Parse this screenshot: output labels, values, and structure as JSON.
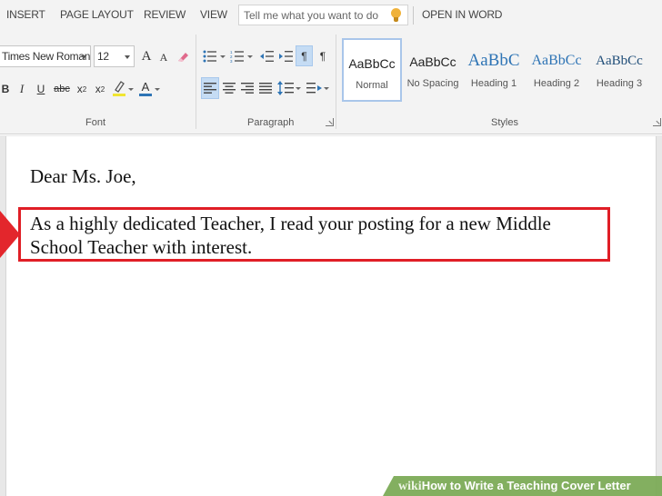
{
  "tabs": [
    "INSERT",
    "PAGE LAYOUT",
    "REVIEW",
    "VIEW"
  ],
  "tell_me": {
    "placeholder": "Tell me what you want to do"
  },
  "open_in_word": "OPEN IN WORD",
  "font_group": {
    "font_name": "Times New Roman",
    "font_size": "12",
    "bold": "B",
    "italic": "I",
    "underline": "U",
    "strike": "abc",
    "grow": "A",
    "shrink": "A",
    "font_color": "A",
    "label": "Font"
  },
  "paragraph_group": {
    "label": "Paragraph",
    "pilcrow": "¶"
  },
  "styles_group": {
    "label": "Styles",
    "sample": "AaBbCc",
    "heading_sample": "AaBbC",
    "styles": [
      "Normal",
      "No Spacing",
      "Heading 1",
      "Heading 2",
      "Heading 3"
    ]
  },
  "document": {
    "salutation": "Dear Ms. Joe,",
    "paragraph": "As a highly dedicated Teacher, I read your posting for a new Middle School Teacher with interest."
  },
  "banner": {
    "wiki": "wiki",
    "text": "How to Write a Teaching Cover Letter"
  },
  "colors": {
    "highlight_box": "#e01e26",
    "pointer": "#e3262c",
    "heading_blue": "#2e74b5",
    "banner_green": "#78a852",
    "selected_fill": "#c5dcf4"
  },
  "icons": [
    "lightbulb-icon",
    "bullets-icon",
    "numbering-icon",
    "multilevel-list-icon",
    "decrease-indent-icon",
    "increase-indent-icon",
    "ltr-icon",
    "show-formatting-icon",
    "align-left-icon",
    "align-center-icon",
    "align-right-icon",
    "justify-icon",
    "line-spacing-icon",
    "paragraph-spacing-icon",
    "clear-formatting-icon",
    "highlight-icon",
    "dialog-launcher-icon",
    "pointer-arrow-icon"
  ]
}
